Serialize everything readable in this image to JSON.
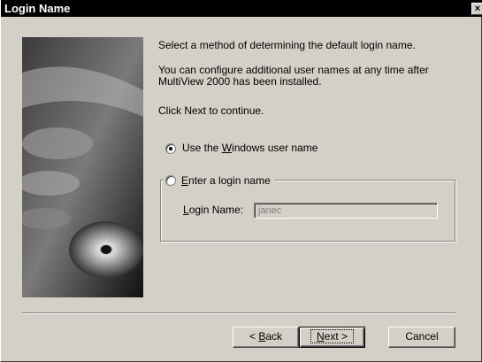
{
  "window": {
    "title": "Login Name",
    "close_glyph": "×"
  },
  "intro": {
    "line1": "Select a method of determining the default login name.",
    "line2a": "You can configure additional user names at any time after",
    "line2b": "MultiView 2000 has been installed.",
    "line3": "Click Next to continue."
  },
  "options": {
    "windows_user": {
      "pre": "Use the ",
      "accel": "W",
      "post": "indows user name",
      "checked": true
    },
    "login_name": {
      "accel": "E",
      "post": "nter a login name",
      "checked": false
    }
  },
  "login_field": {
    "label_accel": "L",
    "label_post": "ogin Name:",
    "value": "janec"
  },
  "buttons": {
    "back": {
      "pre": "< ",
      "accel": "B",
      "post": "ack"
    },
    "next": {
      "accel": "N",
      "post": "ext >"
    },
    "cancel": {
      "label": "Cancel"
    }
  }
}
